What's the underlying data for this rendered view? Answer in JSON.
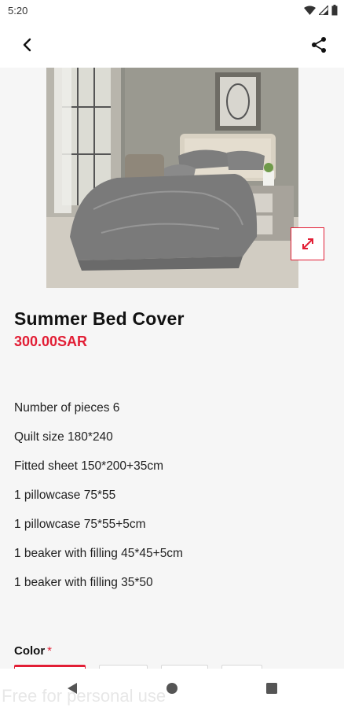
{
  "status": {
    "time": "5:20"
  },
  "product": {
    "title": "Summer Bed Cover",
    "price": "300.00SAR",
    "details": [
      "Number of pieces 6",
      "Quilt size 180*240",
      "Fitted sheet 150*200+35cm",
      "1 pillowcase 75*55",
      "1 pillowcase 75*55+5cm",
      "1 beaker with filling 45*45+5cm",
      "1 beaker with filling 35*50"
    ]
  },
  "options": {
    "color_label": "Color",
    "required_mark": "*"
  },
  "watermark": "Free for personal use",
  "colors": {
    "accent": "#e21e35",
    "background": "#f6f6f6"
  }
}
